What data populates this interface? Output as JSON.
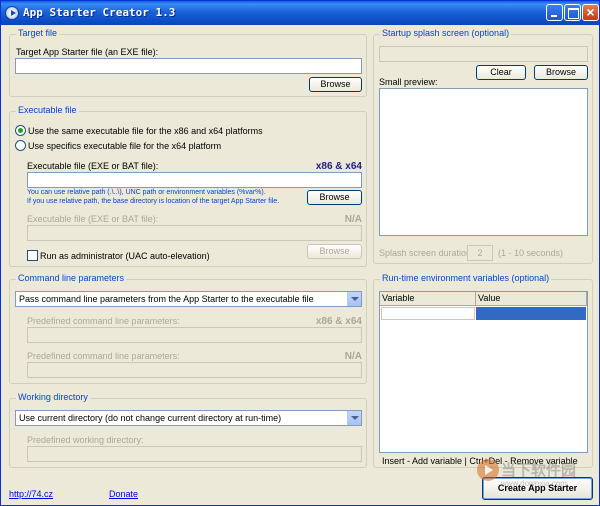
{
  "window": {
    "title": "App Starter Creator 1.3"
  },
  "target": {
    "group_label": "Target file",
    "field_label": "Target App Starter file (an EXE file):",
    "field_value": "",
    "browse_label": "Browse"
  },
  "executable": {
    "group_label": "Executable file",
    "radio_same": "Use the same executable file for the x86 and x64 platforms",
    "radio_specific": "Use specifics executable file for the x64 platform",
    "field_label": "Executable file (EXE or BAT file):",
    "platform_mark": "x86 & x64",
    "field_value": "",
    "hint_line1": "You can use relative path (.\\..\\), UNC path or environment variables (%var%).",
    "hint_line2": "If you use relative path, the base directory is location of the target App Starter file.",
    "browse_label": "Browse",
    "field2_label": "Executable file (EXE or BAT file):",
    "field2_mark": "N/A",
    "browse2_label": "Browse",
    "run_as_admin_label": "Run as administrator (UAC auto-elevation)"
  },
  "cmdline": {
    "group_label": "Command line parameters",
    "combo_value": "Pass command line parameters from the App Starter to the executable file",
    "predef_label": "Predefined command line parameters:",
    "predef_mark": "x86 & x64",
    "predef2_label": "Predefined command line parameters:",
    "predef2_mark": "N/A"
  },
  "workdir": {
    "group_label": "Working directory",
    "combo_value": "Use current directory (do not change current directory at run-time)",
    "predef_label": "Predefined working directory:"
  },
  "splash": {
    "group_label": "Startup splash screen (optional)",
    "clear_label": "Clear",
    "browse_label": "Browse",
    "preview_label": "Small preview:",
    "duration_label": "Splash screen duration:",
    "duration_value": "2",
    "duration_range": "(1 - 10 seconds)"
  },
  "envvars": {
    "group_label": "Run-time environment variables (optional)",
    "col_variable": "Variable",
    "col_value": "Value",
    "hint": "Insert - Add variable | Ctrl+Del - Remove variable"
  },
  "footer": {
    "link_site": "http://74.cz",
    "link_donate": "Donate",
    "create_label": "Create App Starter"
  },
  "watermark": {
    "text": "当下软件园",
    "url": "www.downxia.com"
  },
  "colors": {
    "title_bar": "#0a5fd8",
    "group_label": "#0046d5",
    "selected_cell": "#316ac5"
  }
}
